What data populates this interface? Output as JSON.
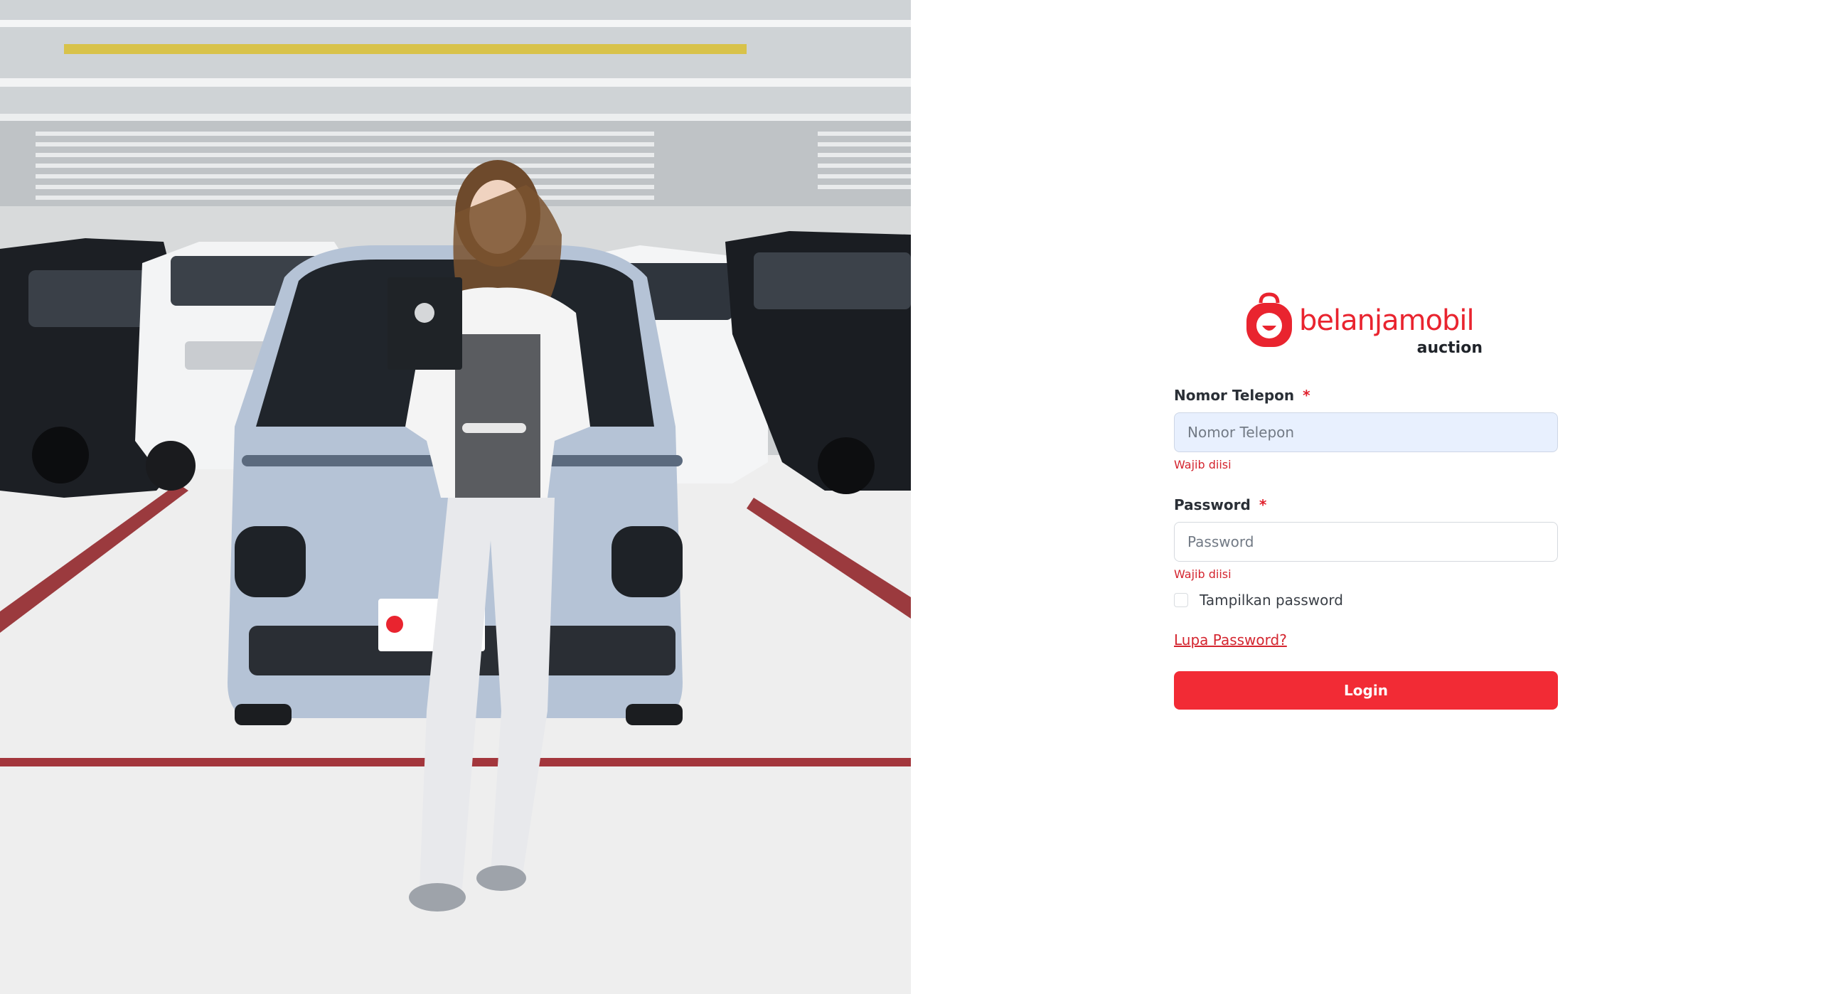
{
  "brand": {
    "name": "belanjamobil",
    "sub": "auction",
    "color": "#e9242f"
  },
  "form": {
    "phone": {
      "label": "Nomor Telepon",
      "required_mark": "*",
      "placeholder": "Nomor Telepon",
      "value": "",
      "error": "Wajib diisi"
    },
    "password": {
      "label": "Password",
      "required_mark": "*",
      "placeholder": "Password",
      "value": "",
      "error": "Wajib diisi"
    },
    "show_password": {
      "label": "Tampilkan password",
      "checked": false
    },
    "forgot_link": "Lupa Password?",
    "login_button": "Login"
  },
  "colors": {
    "accent": "#f22b35",
    "error": "#d4252f",
    "input_autofill_bg": "#e8f0fe"
  }
}
